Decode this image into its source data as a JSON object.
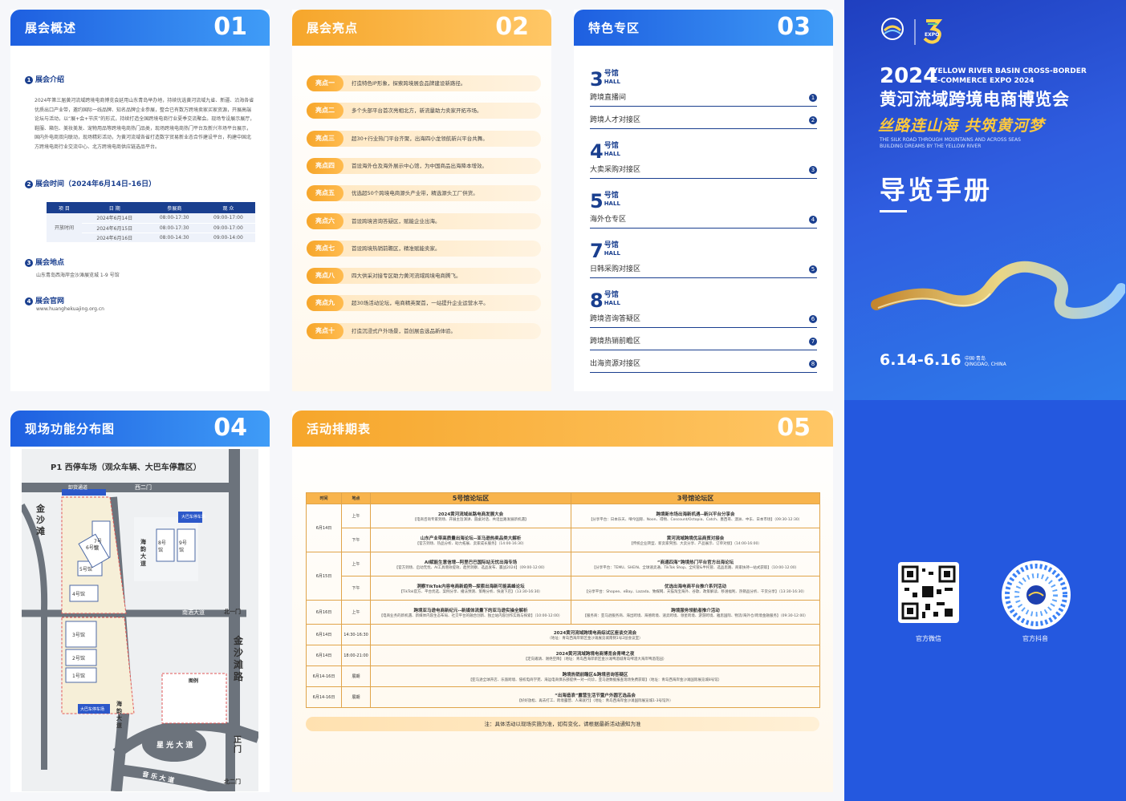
{
  "overview": {
    "title": "展会概述",
    "num": "01",
    "s1": "展会介绍",
    "intro": "2024年第三届黄河流域跨境电商博览会延用山东青岛举办地，持续优选黄河流域九省、新疆、沿海各省优质出口产业带，邀约国际一线品牌、知名品牌企业参展，整合已有数万跨境卖家买家资源，开展高端论坛与活动，以“展+会+节庆”的形式，持续打造全国跨境电商行业夏季交流聚会。现场专设展示展厅，鞋服、箱包、美妆美发、宠物用品等跨境电商热门品类，现场跨境电商热门平台及新兴市场平台展示，国内外电商双向联动，现场精彩活动，为黄河流域各省打造数字贸易新业态合作建设平台，构建中国北方跨境电商行业交流中心、北方跨境电商供应链选品平台。",
    "s2": "展会时间（2024年6月14日-16日）",
    "table_headers": [
      "项 目",
      "日 期",
      "参展商",
      "观 众"
    ],
    "row_label": "开放时间",
    "rows": [
      [
        "2024年6月14日",
        "08:00-17:30",
        "09:00-17:00"
      ],
      [
        "2024年6月15日",
        "08:00-17:30",
        "09:00-17:00"
      ],
      [
        "2024年6月16日",
        "08:00-14:30",
        "09:00-14:00"
      ]
    ],
    "s3": "展会地点",
    "location": "山东青岛西海岸金沙滩展览城 1-9 号馆",
    "s4": "展会官网",
    "website": "www.huanghekuajing.org.cn"
  },
  "highlights": {
    "title": "展会亮点",
    "num": "02",
    "items": [
      {
        "tag": "亮点一",
        "text": "打造特色IP形象，探索跨境展会品牌建设新路径。"
      },
      {
        "tag": "亮点二",
        "text": "多个头部平台首次亮相北方，新流量助力卖家开拓市场。"
      },
      {
        "tag": "亮点三",
        "text": "超30+行业热门平台齐聚，出海四小龙领航新兴平台共舞。"
      },
      {
        "tag": "亮点四",
        "text": "首设海外仓及海外展示中心馆，为中国商品出海降本增效。"
      },
      {
        "tag": "亮点五",
        "text": "优选超50个跨境电商源头产业带，精选源头工厂供货。"
      },
      {
        "tag": "亮点六",
        "text": "首设跨境咨询答疑区，赋能企业出海。"
      },
      {
        "tag": "亮点七",
        "text": "首设跨境热销前瞻区，精准赋能卖家。"
      },
      {
        "tag": "亮点八",
        "text": "四大供采对接专区助力黄河流域跨境电商腾飞。"
      },
      {
        "tag": "亮点九",
        "text": "超30场活动论坛，电商精英聚首，一站提升企业运营水平。"
      },
      {
        "tag": "亮点十",
        "text": "打造沉浸式户外场景，首创展会选品新体验。"
      }
    ]
  },
  "zones": {
    "title": "特色专区",
    "num": "03",
    "hall_word": "号馆",
    "hall_en": "HALL",
    "halls": [
      {
        "no": "3",
        "items": [
          {
            "name": "跨境直播间",
            "c": "1"
          },
          {
            "name": "跨境人才对接区",
            "c": "2"
          }
        ]
      },
      {
        "no": "4",
        "items": [
          {
            "name": "大卖采购对接区",
            "c": "3"
          }
        ]
      },
      {
        "no": "5",
        "items": [
          {
            "name": "海外仓专区",
            "c": "4"
          }
        ]
      },
      {
        "no": "7",
        "items": [
          {
            "name": "日韩采购对接区",
            "c": "5"
          }
        ]
      },
      {
        "no": "8",
        "items": [
          {
            "name": "跨境咨询答疑区",
            "c": "6"
          },
          {
            "name": "跨境热销前瞻区",
            "c": "7"
          },
          {
            "name": "出海资源对接区",
            "c": "8"
          }
        ]
      }
    ]
  },
  "map": {
    "title": "现场功能分布图",
    "num": "04",
    "parking": "P1 西停车场（观众车辆、大巴车停靠区）",
    "unload": "卸货通道",
    "west_gate": "西二门",
    "jinsha": "金沙滩",
    "jinsha_road": "金沙滩路",
    "haiyun": "海韵大道",
    "nanjiu": "南酒大道",
    "north1": "北一门",
    "north2": "北二门",
    "east_gate": "正门",
    "xingguang": "星 光 大 道",
    "yinle": "音 乐 大 道",
    "legend": "图例",
    "bus_park": "大巴车停车场",
    "halls": [
      "9号馆",
      "8号馆",
      "7号馆",
      "6号馆",
      "5号馆",
      "4号馆",
      "3号馆",
      "2号馆",
      "1号馆"
    ]
  },
  "schedule": {
    "title": "活动排期表",
    "num": "05",
    "col_time": "时间",
    "col_site": "地点",
    "hall5": "5号馆论坛区",
    "hall3": "3号馆论坛区",
    "am": "上午",
    "pm": "下午",
    "rows": [
      {
        "date": "6月14日",
        "half": "上午",
        "a_t": "2024黄河流域丝路电商发展大会",
        "a_s": "【电商咨询专家到场、开展主旨演讲、圆桌对话、共话丝路发展新机遇】",
        "b_t": "跨境新市场出海新机遇--新兴平台分享会",
        "b_s": "【分享平台：日本乐天、嘀今国际、Noon、得物、Coscount/Octopia、Catch、墨西哥、澳洲、中东、日本市场】（09:30-12:30）"
      },
      {
        "date": "",
        "half": "下午",
        "a_t": "山东产业带高质量出海论坛--亚马逊热卖品类大解析",
        "a_s": "【官方到场、热品分析、助力拓展、卖家成长服务】（14:00-16:30）",
        "b_t": "黄河流域跨境优品商贸对接会",
        "b_s": "【传统企业转型、新卖家突围、大卖分享、产品展示、订单对接】（14:00-16:00）"
      },
      {
        "date": "6月15日",
        "half": "上午",
        "a_t": "AI赋能生意信增--阿里巴巴国际站无忧出海专场",
        "a_s": "【官方到场、启动无忧、AI工具增效提效、趋势洞察、选品发布、赢战2024】（09:00-12:00）",
        "b_t": "“商通四海”跨境热门平台官方出海论坛",
        "b_s": "【分享平台：TEMU、SHEIN、全球速卖通、TikTok Shop、全托管&半托管、选品思路、商家扶持一站式获取】（10:00-12:00）"
      },
      {
        "date": "",
        "half": "下午",
        "a_t": "洞察TikTok内容电商新趋势--探索出海新可能高峰论坛",
        "a_s": "【TikTok官方、平台优选、案例分享、播法预测、策略分析、快速下店】（13:30-16:30）",
        "b_t": "优选出海电商平台推介系列活动",
        "b_s": "【分享平台：Shopee、eBay、Lazada、致媒网、天猫淘宝海外、谷歌、政策解读、移涵福利、热销品分析、干货分享】（13:30-16:30）"
      },
      {
        "date": "6月16日",
        "half": "上午",
        "a_t": "跨境亚马逊电商新纪元--新媒体流量下的亚马逊实操全解析",
        "a_s": "【电商业务的新机遇、新媒体内容生态布局、社交平台的融合创新、独立站内容创作实践与探索】（10:00-12:00）",
        "b_t": "跨境服务领航者推介活动",
        "b_s": "【服务商：亚马逊服务商、海出跨境、海德跨境、速卖跨境、领星跨境、游游跨境、雅思国际、物流/海外仓/跨境金融服务】（09:30-12:00）"
      }
    ],
    "events": [
      {
        "date": "6月14日",
        "time": "14:30-16:30",
        "t": "2024黄河流域跨境电商综试区座谈交流会",
        "s": "（地址：青岛西海岸新区金沙滩展览城南侧1号2层会议室）"
      },
      {
        "date": "6月14日",
        "time": "18:00-21:00",
        "t": "2024黄河流域跨境电商博览会青啤之夜",
        "s": "【定向邀请、谢绝空降】（地址：青岛西海岸新区金沙滩啤酒城青岛啤酒大海岸啤酒花园）"
      },
      {
        "date": "6月14-16日",
        "time": "展期",
        "t": "跨境热销前瞻区&跨境咨询答疑区",
        "s": "【亚马逊全球开店、乐旅跨境、侵权电商学苑、海运电商俱乐部提供一对一问诊，亚马逊数据报查现场免费获取】（地址：青岛西海岸金沙滩国际展览城8号馆）"
      },
      {
        "date": "6月14-16日",
        "time": "展期",
        "t": "“出海造浪”露营生活节暨户外圆艺选品会",
        "s": "【好好放松、再去打工、跨境露营、人来就行】（地址：青岛西海岸金沙滩国际展览城1-3号馆外）"
      }
    ],
    "note": "注：具体活动以现场实施为准，如有变化，请根据最新活动通知为准"
  },
  "cover": {
    "year": "2024",
    "en1": "YELLOW RIVER BASIN CROSS-BORDER",
    "en2": "E-COMMERCE EXPO 2024",
    "title_cn": "黄河流域跨境电商博览会",
    "slogan": "丝路连山海  共筑黄河梦",
    "en_slogan1": "THE SILK ROAD THROUGH MOUNTAINS AND ACROSS SEAS",
    "en_slogan2": "BUILDING DREAMS BY THE YELLOW RIVER",
    "guide": "导览手册",
    "dates": "6.14-6.16",
    "city_cn": "中国·青岛",
    "city_en": "QINGDAO, CHINA",
    "expo_logo": "EXPO",
    "qr1_label": "官方微信",
    "qr2_label": "官方抖音"
  }
}
